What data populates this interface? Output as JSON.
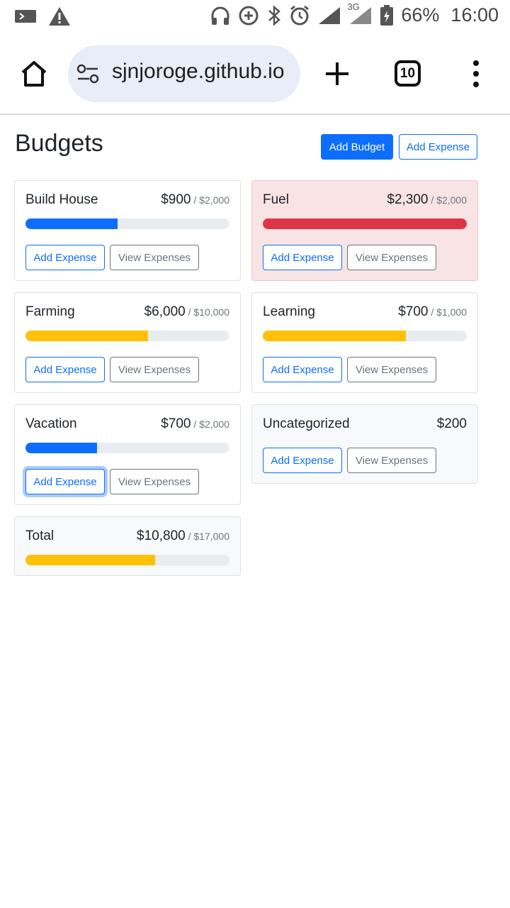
{
  "status_bar": {
    "battery": "66%",
    "time": "16:00",
    "network": "3G"
  },
  "browser": {
    "url": "sjnjoroge.github.io",
    "tab_count": "10"
  },
  "page": {
    "title": "Budgets",
    "add_budget_label": "Add Budget",
    "add_expense_label": "Add Expense"
  },
  "colors": {
    "primary": "#0d6efd",
    "warning": "#ffc107",
    "danger": "#dc3545",
    "track": "#e9ecef"
  },
  "budgets": [
    {
      "name": "Build House",
      "amount": "$900",
      "max": " / $2,000",
      "progress": 0.45,
      "variant": "primary",
      "add_label": "Add Expense",
      "view_label": "View Expenses"
    },
    {
      "name": "Fuel",
      "amount": "$2,300",
      "max": " / $2,000",
      "progress": 1.0,
      "variant": "danger",
      "add_label": "Add Expense",
      "view_label": "View Expenses"
    },
    {
      "name": "Farming",
      "amount": "$6,000",
      "max": " / $10,000",
      "progress": 0.6,
      "variant": "warning",
      "add_label": "Add Expense",
      "view_label": "View Expenses"
    },
    {
      "name": "Learning",
      "amount": "$700",
      "max": " / $1,000",
      "progress": 0.7,
      "variant": "warning",
      "add_label": "Add Expense",
      "view_label": "View Expenses"
    },
    {
      "name": "Vacation",
      "amount": "$700",
      "max": " / $2,000",
      "progress": 0.35,
      "variant": "primary",
      "add_label": "Add Expense",
      "view_label": "View Expenses"
    },
    {
      "name": "Uncategorized",
      "amount": "$200",
      "add_label": "Add Expense",
      "view_label": "View Expenses"
    }
  ],
  "total": {
    "name": "Total",
    "amount": "$10,800",
    "max": " / $17,000",
    "progress": 0.635,
    "variant": "warning"
  }
}
